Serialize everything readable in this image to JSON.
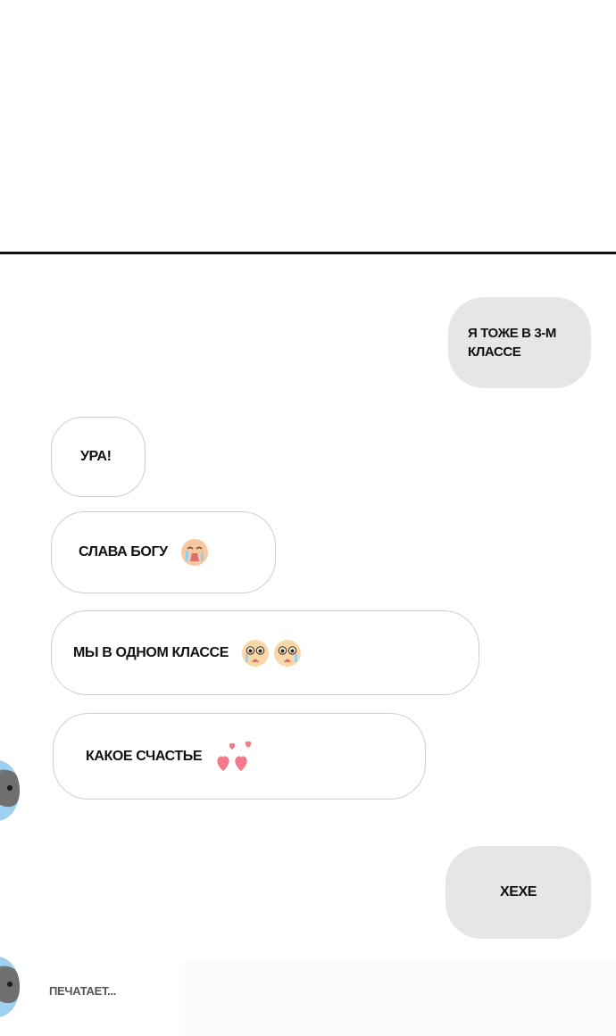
{
  "messages": [
    {
      "id": "m1",
      "side": "outgoing",
      "text": "Я ТОЖЕ В 3-М КЛАССЕ"
    },
    {
      "id": "m2",
      "side": "incoming",
      "text": "УРА!"
    },
    {
      "id": "m3",
      "side": "incoming",
      "text": "СЛАВА БОГУ",
      "emoji": [
        "crying-face"
      ]
    },
    {
      "id": "m4",
      "side": "incoming",
      "text": "МЫ В ОДНОМ КЛАССЕ",
      "emoji": [
        "teary-face",
        "teary-face"
      ]
    },
    {
      "id": "m5",
      "side": "incoming",
      "text": "КАКОЕ СЧАСТЬЕ",
      "emoji": [
        "hearts"
      ]
    },
    {
      "id": "m6",
      "side": "outgoing",
      "text": "ХЕХЕ"
    }
  ],
  "typing_indicator": "ПЕЧАТАЕТ...",
  "colors": {
    "incoming_bubble": "#ffffff",
    "incoming_border": "#cfcfcf",
    "outgoing_bubble": "#e6e6e6",
    "text": "#111111",
    "divider": "#111111"
  }
}
